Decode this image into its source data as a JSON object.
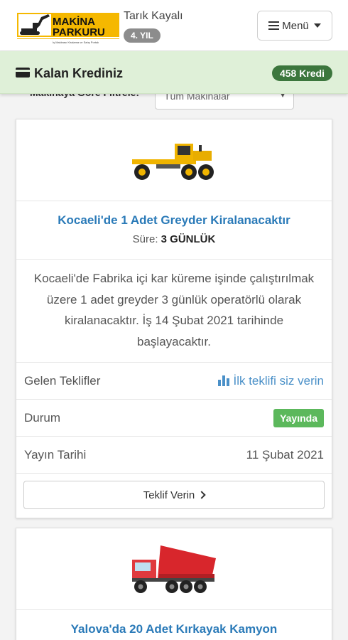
{
  "header": {
    "logo_line1": "MAKİNA",
    "logo_line2": "PARKURU",
    "logo_tagline": "İş Makinası Kiralama ve Satış Portalı",
    "user_name": "Tarık Kayalı",
    "years_badge": "4. YIL",
    "menu_label": "Menü",
    "menu_icon": "bars-icon"
  },
  "credit": {
    "icon": "credit-card-icon",
    "label": "Kalan Krediniz",
    "value": "458 Kredi"
  },
  "filter": {
    "label": "Makinaya Göre Filtrele:",
    "selected": "Tüm Makinalar"
  },
  "listings": [
    {
      "image_icon": "grader-icon",
      "title": "Kocaeli'de 1 Adet Greyder Kiralanacaktır",
      "duration_label": "Süre:",
      "duration_value": "3 GÜNLÜK",
      "description": "Kocaeli'de Fabrika içi kar küreme işinde çalıştırılmak üzere 1 adet greyder 3 günlük operatörlü olarak kiralanacaktır. İş 14 Şubat 2021 tarihinde başlayacaktır.",
      "offers_label": "Gelen Teklifler",
      "offers_link": "İlk teklifi siz verin",
      "status_label": "Durum",
      "status_value": "Yayında",
      "date_label": "Yayın Tarihi",
      "date_value": "11 Şubat 2021",
      "button_label": "Teklif Verin"
    },
    {
      "image_icon": "dump-truck-icon",
      "title": "Yalova'da 20 Adet Kırkayak Kamyon"
    }
  ],
  "colors": {
    "link": "#2a7ab8",
    "credit_bg": "#dff0d8",
    "credit_badge": "#3c763d",
    "status_green": "#5cb85c",
    "logo_yellow": "#f5b800"
  }
}
